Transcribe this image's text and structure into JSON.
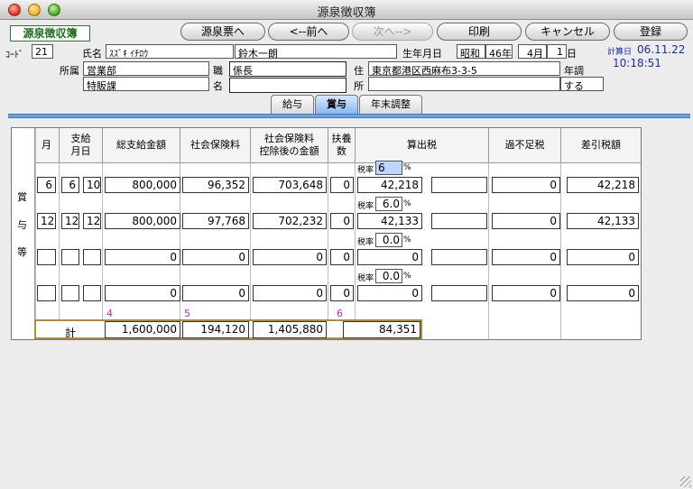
{
  "window": {
    "title": "源泉徴収簿"
  },
  "app": {
    "name": "源泉徴収簿"
  },
  "toolbar": {
    "to_gensen": "源泉票へ",
    "prev": "<--前へ",
    "next": "次へ-->",
    "print": "印刷",
    "cancel": "キャンセル",
    "register": "登録"
  },
  "employee": {
    "code_label": "ｺｰﾄﾞ",
    "code": "21",
    "name_label": "氏名",
    "kana": "ｽｽﾞｷ ｲﾁﾛｳ",
    "name": "鈴木一朗",
    "birth_label": "生年月日",
    "era": "昭和",
    "year": "46",
    "year_unit": "年",
    "month": "4",
    "month_unit": "月",
    "day": "1",
    "day_unit": "日",
    "dept_label": "所属",
    "dept1": "営業部",
    "dept2": "特販課",
    "pos_label_1": "職",
    "pos_label_2": "名",
    "position": "係長",
    "position2": "",
    "addr_label_1": "住",
    "addr_label_2": "所",
    "address": "東京都港区西麻布3-3-5",
    "address2": "",
    "nencho_label_1": "年調",
    "nencho_value": "する"
  },
  "calc": {
    "label": "計算日",
    "date": "06.11.22",
    "time": "10:18:51"
  },
  "tabs": [
    {
      "label": "給与",
      "active": false
    },
    {
      "label": "賞与",
      "active": true
    },
    {
      "label": "年末調整",
      "active": false
    }
  ],
  "table": {
    "side_label": [
      "賞",
      "与",
      "等"
    ],
    "headers": {
      "month": "月",
      "pay_day_1": "支給",
      "pay_day_2": "月日",
      "total": "総支給金額",
      "social": "社会保険料",
      "after_1": "社会保険料",
      "after_2": "控除後の金額",
      "dep_1": "扶養",
      "dep_2": "数",
      "tax": "算出税",
      "over": "過不足税",
      "net": "差引税額"
    },
    "rate_label": "税率",
    "pct": "%",
    "rows": [
      {
        "month": "6",
        "pay_m": "6",
        "pay_d": "10",
        "total": "800,000",
        "social": "96,352",
        "after": "703,648",
        "dep": "0",
        "rate": "6",
        "tax": "42,218",
        "blank": "",
        "over": "0",
        "net": "42,218"
      },
      {
        "month": "12",
        "pay_m": "12",
        "pay_d": "12",
        "total": "800,000",
        "social": "97,768",
        "after": "702,232",
        "dep": "0",
        "rate": "6.0",
        "tax": "42,133",
        "blank": "",
        "over": "0",
        "net": "42,133"
      },
      {
        "month": "",
        "pay_m": "",
        "pay_d": "",
        "total": "0",
        "social": "0",
        "after": "0",
        "dep": "0",
        "rate": "0.0",
        "tax": "0",
        "blank": "",
        "over": "0",
        "net": "0"
      },
      {
        "month": "",
        "pay_m": "",
        "pay_d": "",
        "total": "0",
        "social": "0",
        "after": "0",
        "dep": "0",
        "rate": "0.0",
        "tax": "0",
        "blank": "",
        "over": "0",
        "net": "0"
      }
    ],
    "marks": {
      "total": "4",
      "social": "5",
      "dep": "6"
    },
    "totals": {
      "label": "計",
      "total": "1,600,000",
      "social": "194,120",
      "after": "1,405,880",
      "tax": "84,351"
    }
  }
}
